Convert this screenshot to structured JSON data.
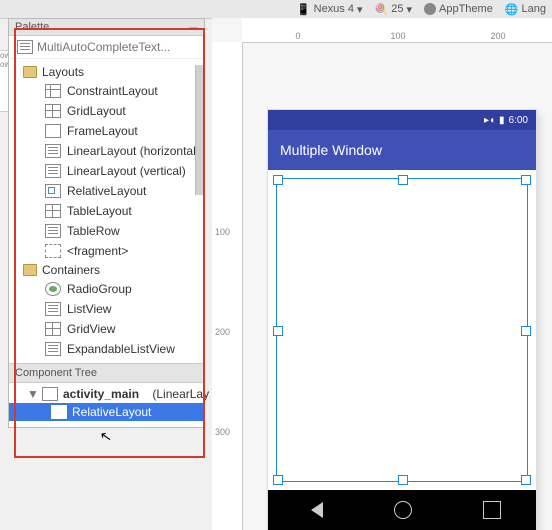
{
  "toolbar": {
    "device": "Nexus 4",
    "api": "25",
    "theme": "AppTheme",
    "lang": "Lang"
  },
  "panel": {
    "title": "Palette",
    "collapse": "—",
    "prev_item": "MultiAutoCompleteText..."
  },
  "layouts": {
    "label": "Layouts",
    "items": [
      "ConstraintLayout",
      "GridLayout",
      "FrameLayout",
      "LinearLayout (horizontal)",
      "LinearLayout (vertical)",
      "RelativeLayout",
      "TableLayout",
      "TableRow",
      "<fragment>"
    ]
  },
  "containers": {
    "label": "Containers",
    "items": [
      "RadioGroup",
      "ListView",
      "GridView",
      "ExpandableListView"
    ]
  },
  "component_tree": {
    "title": "Component Tree",
    "root": "activity_main",
    "root_type": "(LinearLay",
    "child": "RelativeLayout"
  },
  "rulers": {
    "h0": "0",
    "h100": "100",
    "h200": "200",
    "v100": "100",
    "v200": "200",
    "v300": "300"
  },
  "phone": {
    "clock": "6:00",
    "title": "Multiple Window"
  },
  "left_strip": "ow\now"
}
